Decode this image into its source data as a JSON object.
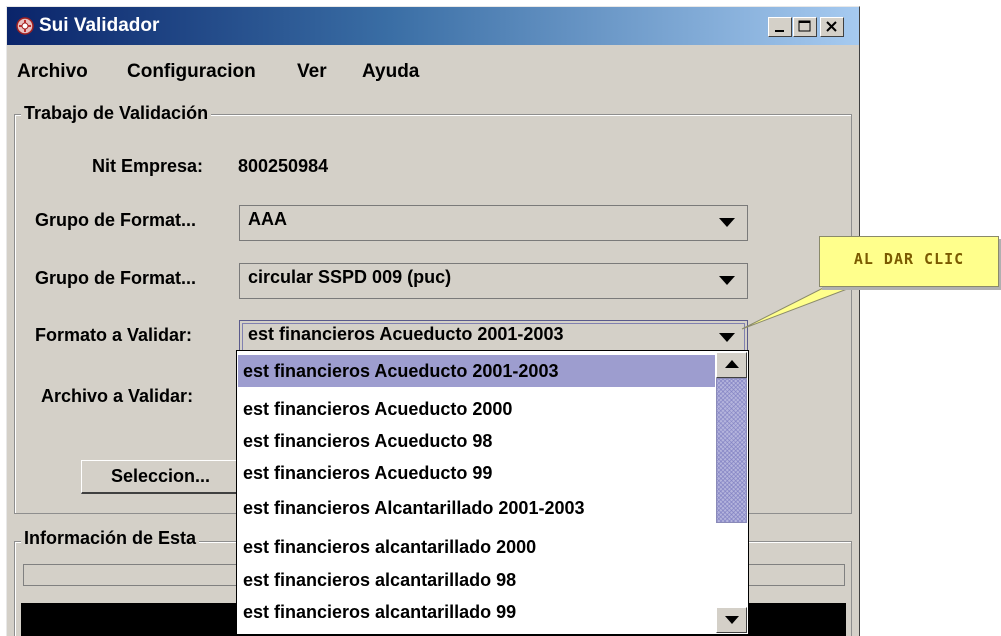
{
  "window": {
    "title": "Sui Validador",
    "title_icon": "app-logo-icon",
    "minimize_icon": "minimize-icon",
    "maximize_icon": "maximize-icon",
    "close_icon": "close-icon"
  },
  "menu": [
    "Archivo",
    "Configuracion",
    "Ver",
    "Ayuda"
  ],
  "trabajo": {
    "title": "Trabajo de Validación",
    "nit_label": "Nit Empresa:",
    "nit_value": "800250984",
    "grupo1_label": "Grupo de Format...",
    "grupo1_value": "AAA",
    "grupo2_label": "Grupo de Format...",
    "grupo2_value": "circular SSPD 009 (puc)",
    "formato_label": "Formato a Validar:",
    "formato_value": "est financieros Acueducto 2001-2003",
    "archivo_label": "Archivo a Validar:",
    "seleccion_button": "Seleccion..."
  },
  "info": {
    "title": "Información de Esta"
  },
  "dropdown": {
    "items": [
      "est financieros Acueducto 2001-2003",
      "est financieros Acueducto 2000",
      "est financieros Acueducto 98",
      "est financieros Acueducto 99",
      "est financieros Alcantarillado 2001-2003",
      "est financieros alcantarillado 2000",
      "est financieros alcantarillado 98",
      "est financieros alcantarillado 99"
    ],
    "selected_index": 0
  },
  "callout": {
    "text": "AL DAR CLIC"
  },
  "colors": {
    "title_gradient_start": "#0a246a",
    "title_gradient_end": "#a6caf0",
    "selection": "#9d9dcf",
    "callout_fill": "#ffff8c",
    "callout_text": "#7a5a00"
  }
}
